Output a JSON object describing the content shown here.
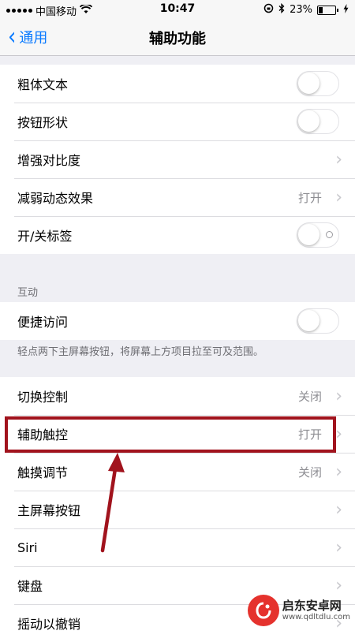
{
  "status_bar": {
    "carrier": "中国移动",
    "time": "10:47",
    "battery": "23%",
    "battery_level": 0.23
  },
  "nav": {
    "back_label": "通用",
    "title": "辅助功能"
  },
  "group1": [
    {
      "label": "粗体文本",
      "control": "toggle"
    },
    {
      "label": "按钮形状",
      "control": "toggle"
    },
    {
      "label": "增强对比度",
      "control": "chevron"
    },
    {
      "label": "减弱动态效果",
      "value": "打开",
      "control": "chevron"
    },
    {
      "label": "开/关标签",
      "control": "toggle-labeled"
    }
  ],
  "interaction": {
    "header": "互动",
    "row_label": "便捷访问",
    "footer": "轻点两下主屏幕按钮，将屏幕上方项目拉至可及范围。"
  },
  "group3": [
    {
      "label": "切换控制",
      "value": "关闭"
    },
    {
      "label": "辅助触控",
      "value": "打开"
    },
    {
      "label": "触摸调节",
      "value": "关闭"
    },
    {
      "label": "主屏幕按钮",
      "value": ""
    },
    {
      "label": "Siri",
      "value": ""
    },
    {
      "label": "键盘",
      "value": ""
    },
    {
      "label": "摇动以撤销",
      "value": ""
    }
  ],
  "annotation": {
    "color": "#a1131d"
  },
  "watermark": {
    "title": "启东安卓网",
    "url": "www.qdltdlu.com"
  },
  "colors": {
    "accent": "#0a7aff",
    "background": "#efeff4"
  }
}
